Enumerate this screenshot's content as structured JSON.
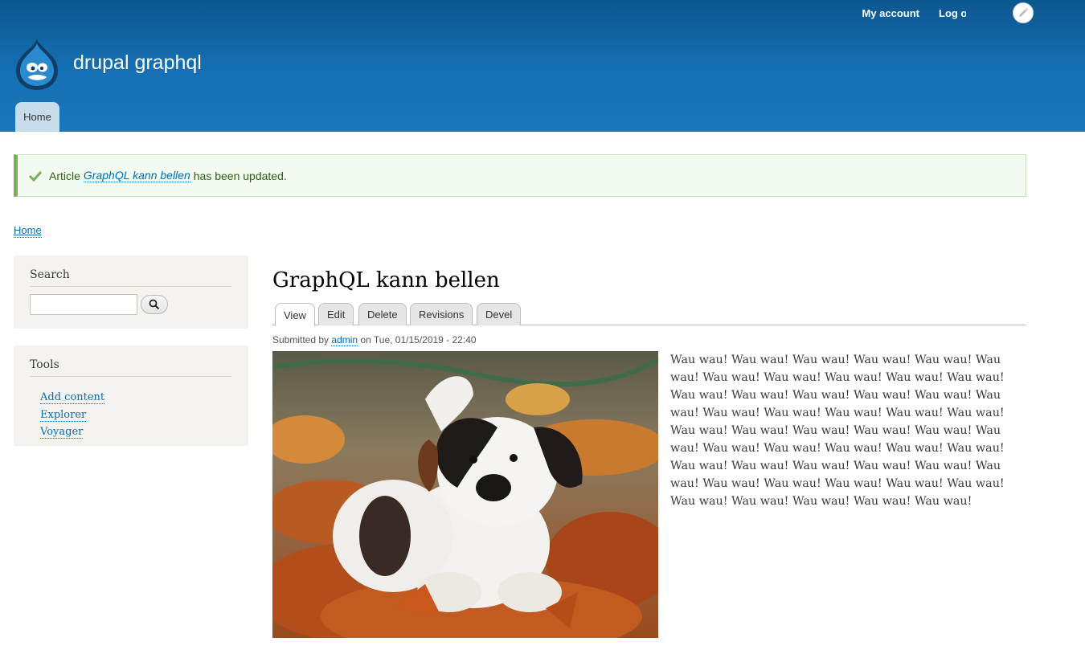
{
  "header": {
    "site_name": "drupal graphql",
    "secondary_menu": {
      "my_account": "My account",
      "log_out": "Log out"
    },
    "primary_tabs": [
      {
        "label": "Home"
      }
    ],
    "colors": {
      "header_top": "#0d5790",
      "header_bottom": "#1a77ba",
      "tab_bg": "#c9dcec"
    }
  },
  "message": {
    "prefix": "Article",
    "link_text": "GraphQL kann bellen",
    "suffix": "has been updated.",
    "icon": "checkmark-icon",
    "colors": {
      "bg": "#f3faef",
      "accent": "#77b259"
    }
  },
  "breadcrumb": {
    "home": "Home"
  },
  "sidebar": {
    "search": {
      "title": "Search",
      "input_value": "",
      "button_icon": "search-icon"
    },
    "tools": {
      "title": "Tools",
      "links": [
        {
          "label": "Add content"
        },
        {
          "label": "Explorer"
        },
        {
          "label": "Voyager"
        }
      ]
    }
  },
  "main": {
    "title": "GraphQL kann bellen",
    "tabs": [
      {
        "label": "View",
        "active": true
      },
      {
        "label": "Edit"
      },
      {
        "label": "Delete"
      },
      {
        "label": "Revisions"
      },
      {
        "label": "Devel"
      }
    ],
    "submitted": {
      "prefix": "Submitted by",
      "author": "admin",
      "date": "on Tue, 01/15/2019 - 22:40"
    },
    "image": "puppy-in-autumn-leaves",
    "body": "Wau wau! Wau wau! Wau wau! Wau wau! Wau wau! Wau wau! Wau wau! Wau wau! Wau wau! Wau wau! Wau wau! Wau wau! Wau wau! Wau wau! Wau wau! Wau wau! Wau wau! Wau wau! Wau wau! Wau wau! Wau wau! Wau wau! Wau wau! Wau wau! Wau wau! Wau wau! Wau wau! Wau wau! Wau wau! Wau wau! Wau wau! Wau wau! Wau wau! Wau wau! Wau wau! Wau wau! Wau wau! Wau wau! Wau wau! Wau wau! Wau wau! Wau wau! Wau wau! Wau wau! Wau wau! Wau wau! Wau wau! Wau wau! Wau wau!"
  }
}
